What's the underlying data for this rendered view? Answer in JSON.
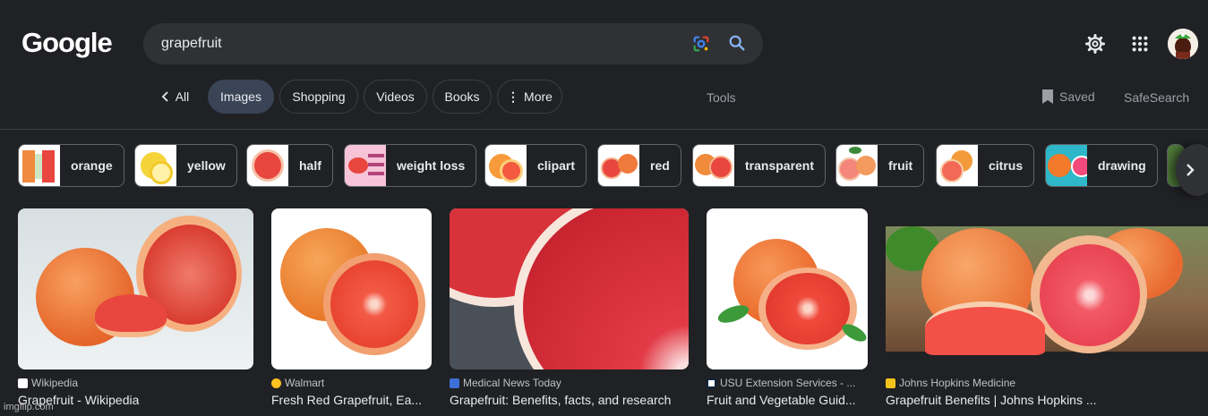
{
  "header": {
    "logo": "Google",
    "query": "grapefruit",
    "icons": [
      "google-lens-icon",
      "search-icon",
      "settings-gear-icon",
      "apps-grid-icon",
      "avatar"
    ]
  },
  "tabs": {
    "back_label": "All",
    "items": [
      {
        "label": "Images",
        "active": true
      },
      {
        "label": "Shopping"
      },
      {
        "label": "Videos"
      },
      {
        "label": "Books"
      },
      {
        "label": "More"
      }
    ],
    "tools": "Tools",
    "saved": "Saved",
    "safesearch": "SafeSearch"
  },
  "chips": [
    "orange",
    "yellow",
    "half",
    "weight loss",
    "clipart",
    "red",
    "transparent",
    "fruit",
    "citrus",
    "drawing"
  ],
  "results": [
    {
      "source": "Wikipedia",
      "title": "Grapefruit - Wikipedia"
    },
    {
      "source": "Walmart",
      "title": "Fresh Red Grapefruit, Ea..."
    },
    {
      "source": "Medical News Today",
      "title": "Grapefruit: Benefits, facts, and research"
    },
    {
      "source": "USU Extension Services - ...",
      "title": "Fruit and Vegetable Guid..."
    },
    {
      "source": "Johns Hopkins Medicine",
      "title": "Grapefruit Benefits | Johns Hopkins ..."
    }
  ],
  "watermark": "imgflip.com",
  "colors": {
    "background": "#202124",
    "search_bg": "#303134",
    "active_tab": "#394457",
    "grapefruit_flesh": "#e8463e",
    "grapefruit_peel": "#f08a3c"
  }
}
